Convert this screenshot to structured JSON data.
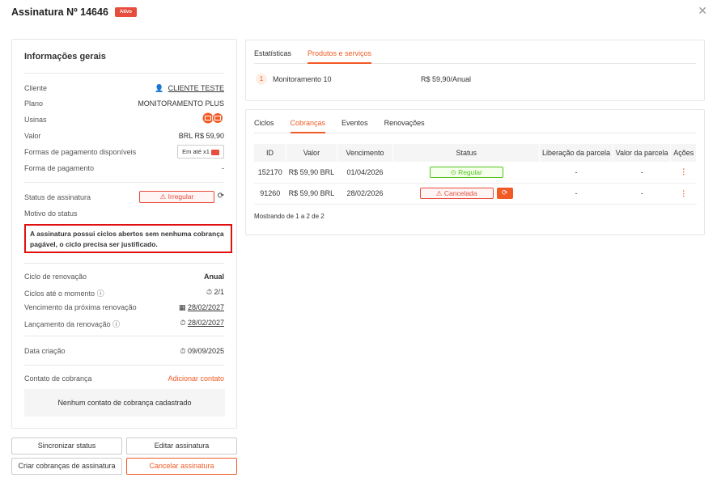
{
  "header": {
    "title": "Assinatura Nº 14646",
    "badge": "Ativo"
  },
  "left": {
    "title": "Informações gerais",
    "cliente_label": "Cliente",
    "cliente_value": "CLIENTE TESTE",
    "plano_label": "Plano",
    "plano_value": "MONITORAMENTO PLUS",
    "usinas_label": "Usinas",
    "valor_label": "Valor",
    "valor_value": "BRL R$ 59,90",
    "formas_label": "Formas de pagamento disponíveis",
    "formas_value": "Em até x1",
    "forma_label": "Forma de pagamento",
    "forma_value": "-",
    "status_label": "Status de assinatura",
    "status_value": "Irregular",
    "motivo_label": "Motivo do status",
    "motivo_text": "A assinatura possui ciclos abertos sem nenhuma cobrança pagável, o ciclo precisa ser justificado.",
    "ciclo_label": "Ciclo de renovação",
    "ciclo_value": "Anual",
    "ciclos_label": "Ciclos até o momento",
    "ciclos_value": "2/1",
    "venc_label": "Vencimento da próxima renovação",
    "venc_value": "28/02/2027",
    "lanc_label": "Lançamento da renovação",
    "lanc_value": "28/02/2027",
    "criacao_label": "Data criação",
    "criacao_value": "09/09/2025",
    "contato_label": "Contato de cobrança",
    "contato_add": "Adicionar contato",
    "contato_empty": "Nenhum contato de cobrança cadastrado"
  },
  "buttons": {
    "sync": "Sincronizar status",
    "edit": "Editar assinatura",
    "create": "Criar cobranças de assinatura",
    "cancel": "Cancelar assinatura"
  },
  "products": {
    "tabs": [
      "Estatísticas",
      "Produtos e serviços"
    ],
    "item_num": "1",
    "item_name": "Monitoramento 10",
    "item_price": "R$ 59,90/Anual"
  },
  "billing": {
    "tabs": [
      "Ciclos",
      "Cobranças",
      "Eventos",
      "Renovações"
    ],
    "headers": [
      "ID",
      "Valor",
      "Vencimento",
      "Status",
      "Liberação da parcela",
      "Valor da parcela",
      "Ações"
    ],
    "rows": [
      {
        "id": "152170",
        "valor": "R$ 59,90  BRL",
        "venc": "01/04/2026",
        "status": "Regular",
        "lib": "-",
        "vparc": "-"
      },
      {
        "id": "91260",
        "valor": "R$ 59,90  BRL",
        "venc": "28/02/2026",
        "status": "Cancelada",
        "lib": "-",
        "vparc": "-"
      }
    ],
    "showing": "Mostrando de 1 a 2 de 2"
  },
  "colors": {
    "accent": "#f15a24",
    "danger": "#e74c3c",
    "success": "#52c41a"
  }
}
